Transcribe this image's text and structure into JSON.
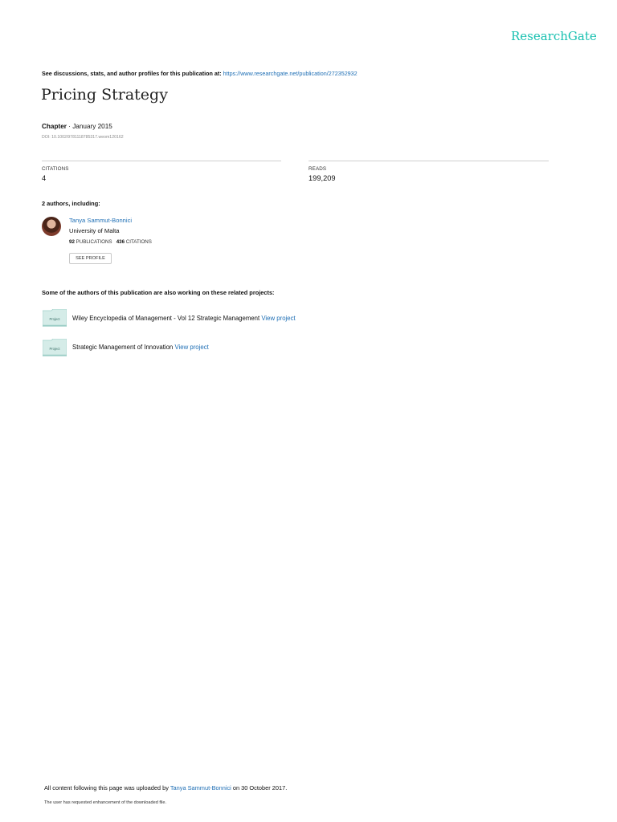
{
  "brand": "ResearchGate",
  "header": {
    "discuss_text": "See discussions, stats, and author profiles for this publication at: ",
    "discuss_link": "https://www.researchgate.net/publication/272352932"
  },
  "publication": {
    "title": "Pricing Strategy",
    "type": "Chapter",
    "date": " · January 2015",
    "doi": "DOI: 10.1002/9781118785317.weom120162"
  },
  "stats": {
    "citations_label": "CITATIONS",
    "citations_value": "4",
    "reads_label": "READS",
    "reads_value": "199,209"
  },
  "authors_header": "2 authors, including:",
  "author": {
    "name": "Tanya Sammut-Bonnici",
    "institution": "University of Malta",
    "publications_count": "92",
    "publications_label": " PUBLICATIONS",
    "citations_count": "436",
    "citations_label": " CITATIONS",
    "see_profile": "SEE PROFILE"
  },
  "related_header": "Some of the authors of this publication are also working on these related projects:",
  "projects": [
    {
      "folder_label": "Project",
      "title": "Wiley Encyclopedia of Management - Vol 12 Strategic Management ",
      "link": "View project"
    },
    {
      "folder_label": "Project",
      "title": "Strategic Management of Innovation ",
      "link": "View project"
    }
  ],
  "footer": {
    "prefix": "All content following this page was uploaded by ",
    "uploader": "Tanya Sammut-Bonnici",
    "suffix": " on 30 October 2017.",
    "note": "The user has requested enhancement of the downloaded file."
  },
  "colors": {
    "brand": "#17c0b0",
    "link": "#1f6fb5",
    "folder_fill": "#d5ece8",
    "folder_edge": "#9fcfc8"
  },
  "icons": {
    "avatar": "author-photo",
    "folder": "project-folder-icon"
  }
}
